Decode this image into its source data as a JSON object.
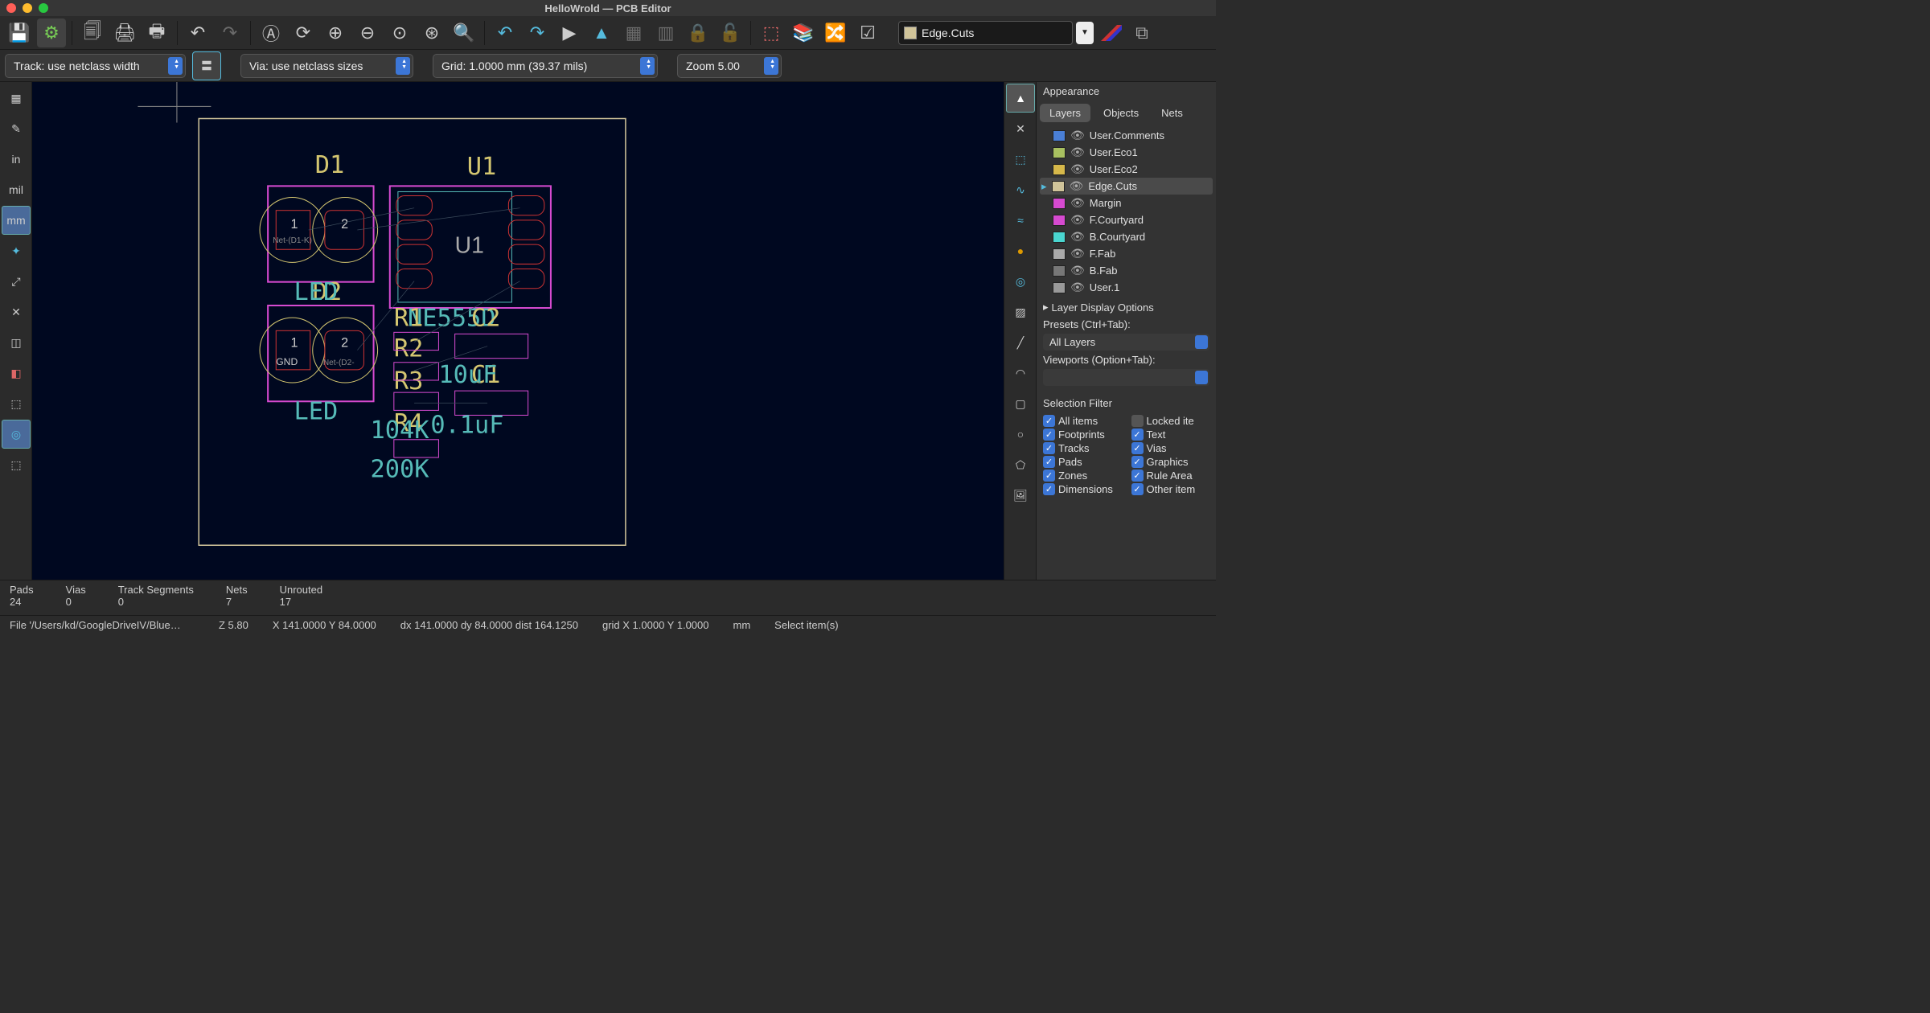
{
  "window": {
    "title": "HelloWrold — PCB Editor"
  },
  "toolbar2": {
    "track": "Track: use netclass width",
    "via": "Via: use netclass sizes",
    "grid": "Grid: 1.0000 mm (39.37 mils)",
    "zoom": "Zoom 5.00"
  },
  "layer_picker": {
    "name": "Edge.Cuts"
  },
  "left_tools": {
    "unit_in": "in",
    "unit_mil": "mil",
    "unit_mm": "mm"
  },
  "appearance": {
    "title": "Appearance",
    "tabs": [
      "Layers",
      "Objects",
      "Nets"
    ],
    "layers": [
      {
        "name": "User.Comments",
        "color": "#4a7fd6"
      },
      {
        "name": "User.Eco1",
        "color": "#a8c060"
      },
      {
        "name": "User.Eco2",
        "color": "#d6b84a"
      },
      {
        "name": "Edge.Cuts",
        "color": "#d0c49a",
        "selected": true
      },
      {
        "name": "Margin",
        "color": "#d64ad0"
      },
      {
        "name": "F.Courtyard",
        "color": "#d64ad0"
      },
      {
        "name": "B.Courtyard",
        "color": "#4ad6d0"
      },
      {
        "name": "F.Fab",
        "color": "#aaaaaa"
      },
      {
        "name": "B.Fab",
        "color": "#777777"
      },
      {
        "name": "User.1",
        "color": "#999999"
      }
    ],
    "layer_display": "Layer Display Options",
    "presets_label": "Presets (Ctrl+Tab):",
    "presets_value": "All Layers",
    "viewports_label": "Viewports (Option+Tab):",
    "selection_filter": "Selection Filter",
    "filters": {
      "all": "All items",
      "locked": "Locked ite",
      "footprints": "Footprints",
      "text": "Text",
      "tracks": "Tracks",
      "vias": "Vias",
      "pads": "Pads",
      "graphics": "Graphics",
      "zones": "Zones",
      "rule": "Rule Area",
      "dimensions": "Dimensions",
      "other": "Other item"
    }
  },
  "canvas": {
    "labels": {
      "D1": "D1",
      "D2": "D2",
      "U1": "U1",
      "R1": "R1",
      "R2": "R2",
      "R3": "R3",
      "R4": "R4",
      "C1": "C1",
      "C2": "C2",
      "LED_top": "LED",
      "LED_bot": "LED",
      "NE555D": "NE555D",
      "uF10": "10uF",
      "uF01": "0.1uF",
      "v104K": "104K",
      "v200K": "200K",
      "U1inner": "U1",
      "pad1a": "1",
      "pad2a": "2",
      "pad1b": "1",
      "pad2b": "2",
      "gnd": "GND",
      "netd1k": "Net-(D1-K)",
      "netd2": "Net-(D2-"
    }
  },
  "status1": {
    "pads_l": "Pads",
    "pads_v": "24",
    "vias_l": "Vias",
    "vias_v": "0",
    "tracks_l": "Track Segments",
    "tracks_v": "0",
    "nets_l": "Nets",
    "nets_v": "7",
    "unrouted_l": "Unrouted",
    "unrouted_v": "17"
  },
  "status2": {
    "file": "File '/Users/kd/GoogleDriveIV/Blue…",
    "z": "Z 5.80",
    "xy": "X 141.0000  Y 84.0000",
    "dxy": "dx 141.0000  dy 84.0000  dist 164.1250",
    "grid": "grid X 1.0000  Y 1.0000",
    "unit": "mm",
    "hint": "Select item(s)"
  }
}
